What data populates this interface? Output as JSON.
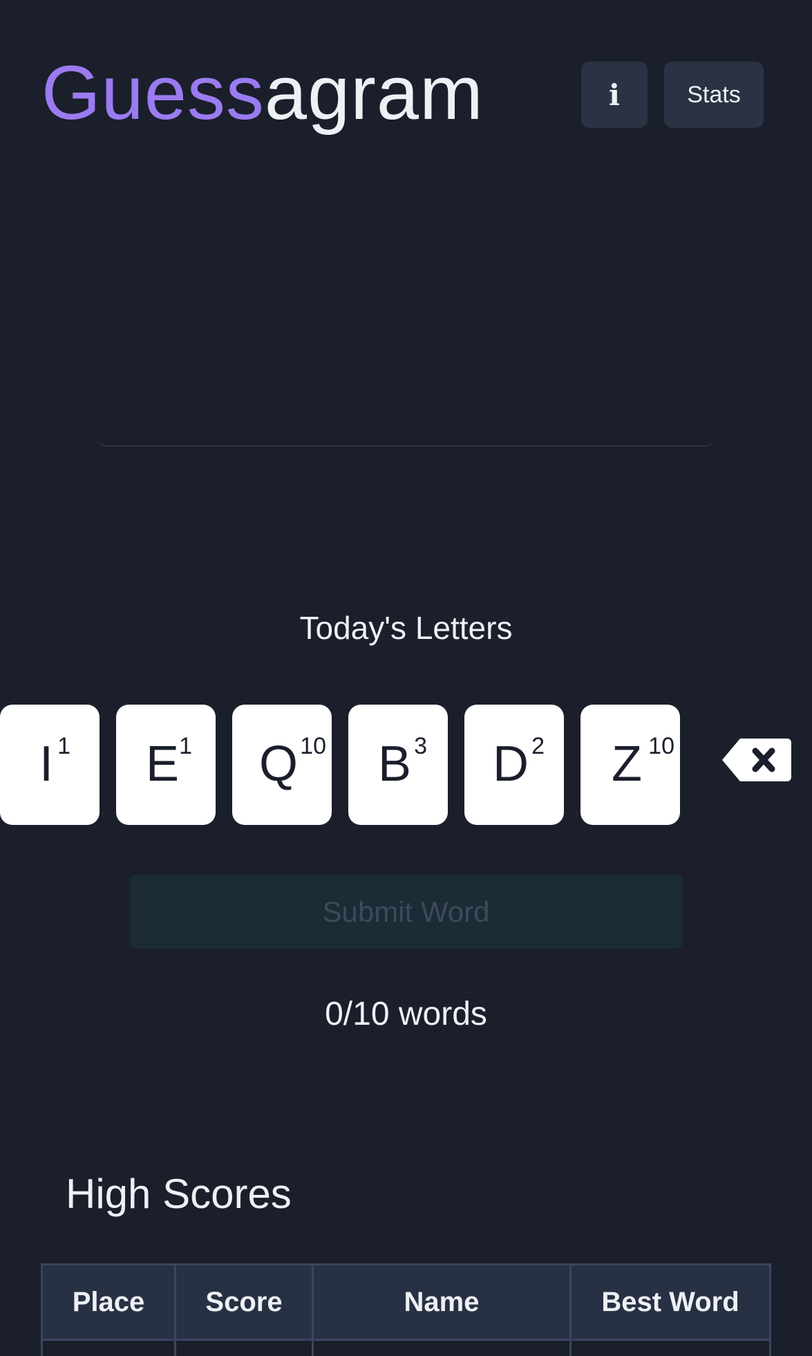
{
  "app": {
    "title_accent": "Guess",
    "title_rest": "agram",
    "info_label": "i",
    "stats_label": "Stats"
  },
  "letters": {
    "heading": "Today's Letters",
    "tiles": [
      {
        "letter": "I",
        "points": "1"
      },
      {
        "letter": "E",
        "points": "1"
      },
      {
        "letter": "Q",
        "points": "10"
      },
      {
        "letter": "B",
        "points": "3"
      },
      {
        "letter": "D",
        "points": "2"
      },
      {
        "letter": "Z",
        "points": "10"
      }
    ]
  },
  "submit": {
    "label": "Submit Word"
  },
  "progress": {
    "text": "0/10 words"
  },
  "high_scores": {
    "title": "High Scores",
    "columns": [
      "Place",
      "Score",
      "Name",
      "Best Word"
    ]
  },
  "colors": {
    "accent": "#9b7bf0",
    "background": "#1a1f2b",
    "button": "#2a3244",
    "submit_disabled": "#1b2c36"
  },
  "icons": {
    "info": "info-icon",
    "backspace": "backspace-icon"
  }
}
